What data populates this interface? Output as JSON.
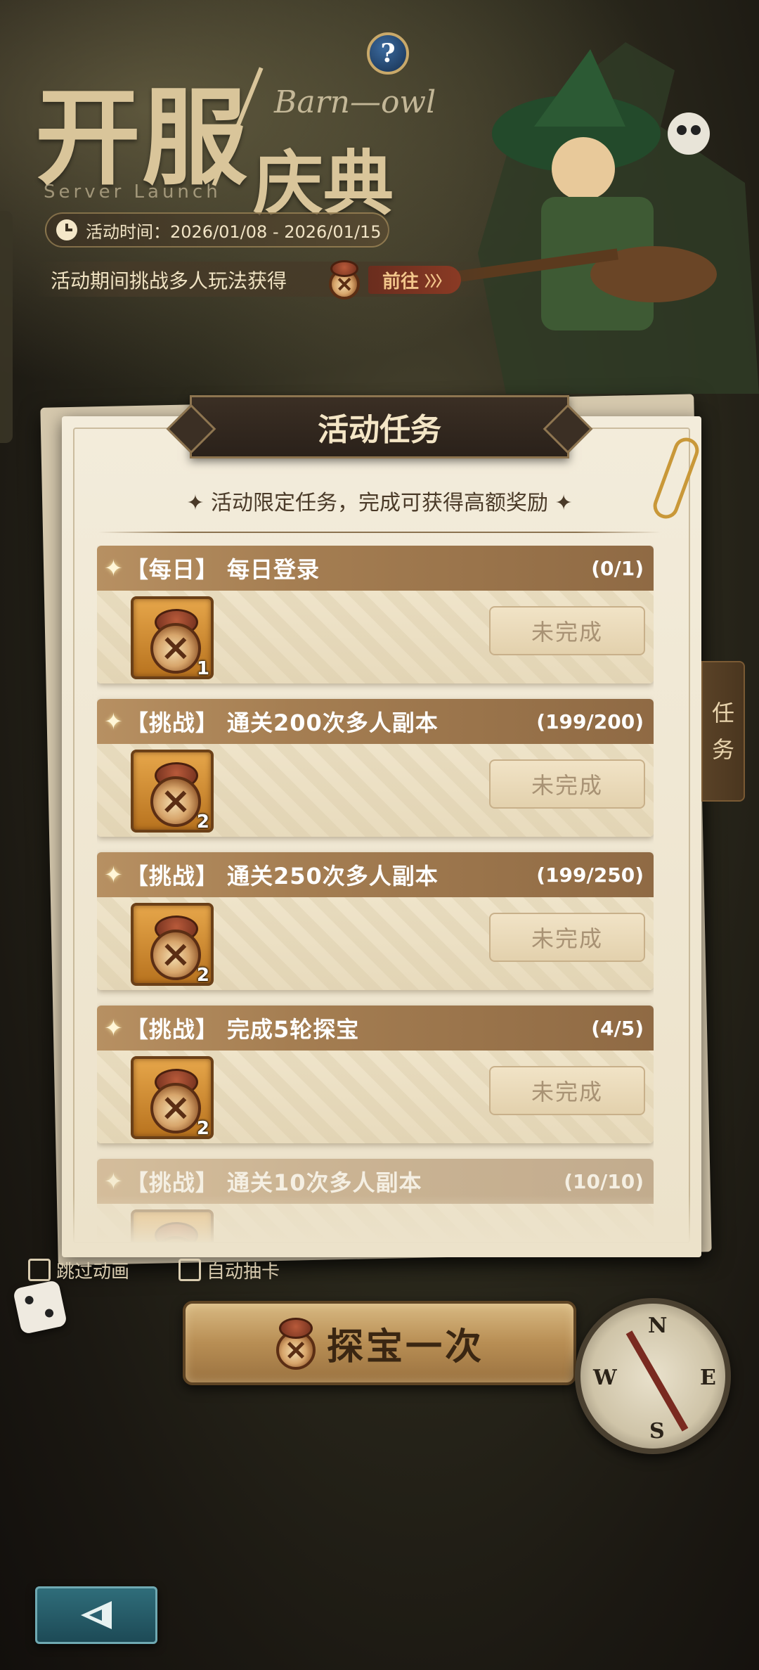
{
  "header": {
    "help_label": "?",
    "title_main": "开服",
    "title_sub": "庆典",
    "title_script": "Barn—owl",
    "title_en": "Server Launch",
    "time_label": "活动时间：2026/01/08 - 2026/01/15",
    "event_text": "活动期间挑战多人玩法获得",
    "goto_label": "前往",
    "goto_arrows": "〉〉〉"
  },
  "panel": {
    "title": "活动任务",
    "subtitle": "✦ 活动限定任务，完成可获得高额奖励 ✦",
    "side_tab": [
      "任",
      "务"
    ]
  },
  "tasks": [
    {
      "title": "【每日】 每日登录",
      "progress": "(0/1)",
      "reward_count": "1",
      "status": "未完成"
    },
    {
      "title": "【挑战】 通关200次多人副本",
      "progress": "(199/200)",
      "reward_count": "2",
      "status": "未完成"
    },
    {
      "title": "【挑战】 通关250次多人副本",
      "progress": "(199/250)",
      "reward_count": "2",
      "status": "未完成"
    },
    {
      "title": "【挑战】 完成5轮探宝",
      "progress": "(4/5)",
      "reward_count": "2",
      "status": "未完成"
    },
    {
      "title": "【挑战】 通关10次多人副本",
      "progress": "(10/10)",
      "reward_count": "",
      "status": ""
    }
  ],
  "bottom": {
    "toggle_skip": "跳过动画",
    "toggle_auto": "自动抽卡",
    "explore_label": "探宝一次",
    "compass_letters": {
      "n": "N",
      "e": "E",
      "s": "S",
      "w": "W"
    }
  },
  "colors": {
    "accent_gold": "#d9c59a",
    "task_header": "#a57e52",
    "back_button": "#2f6d7a"
  }
}
